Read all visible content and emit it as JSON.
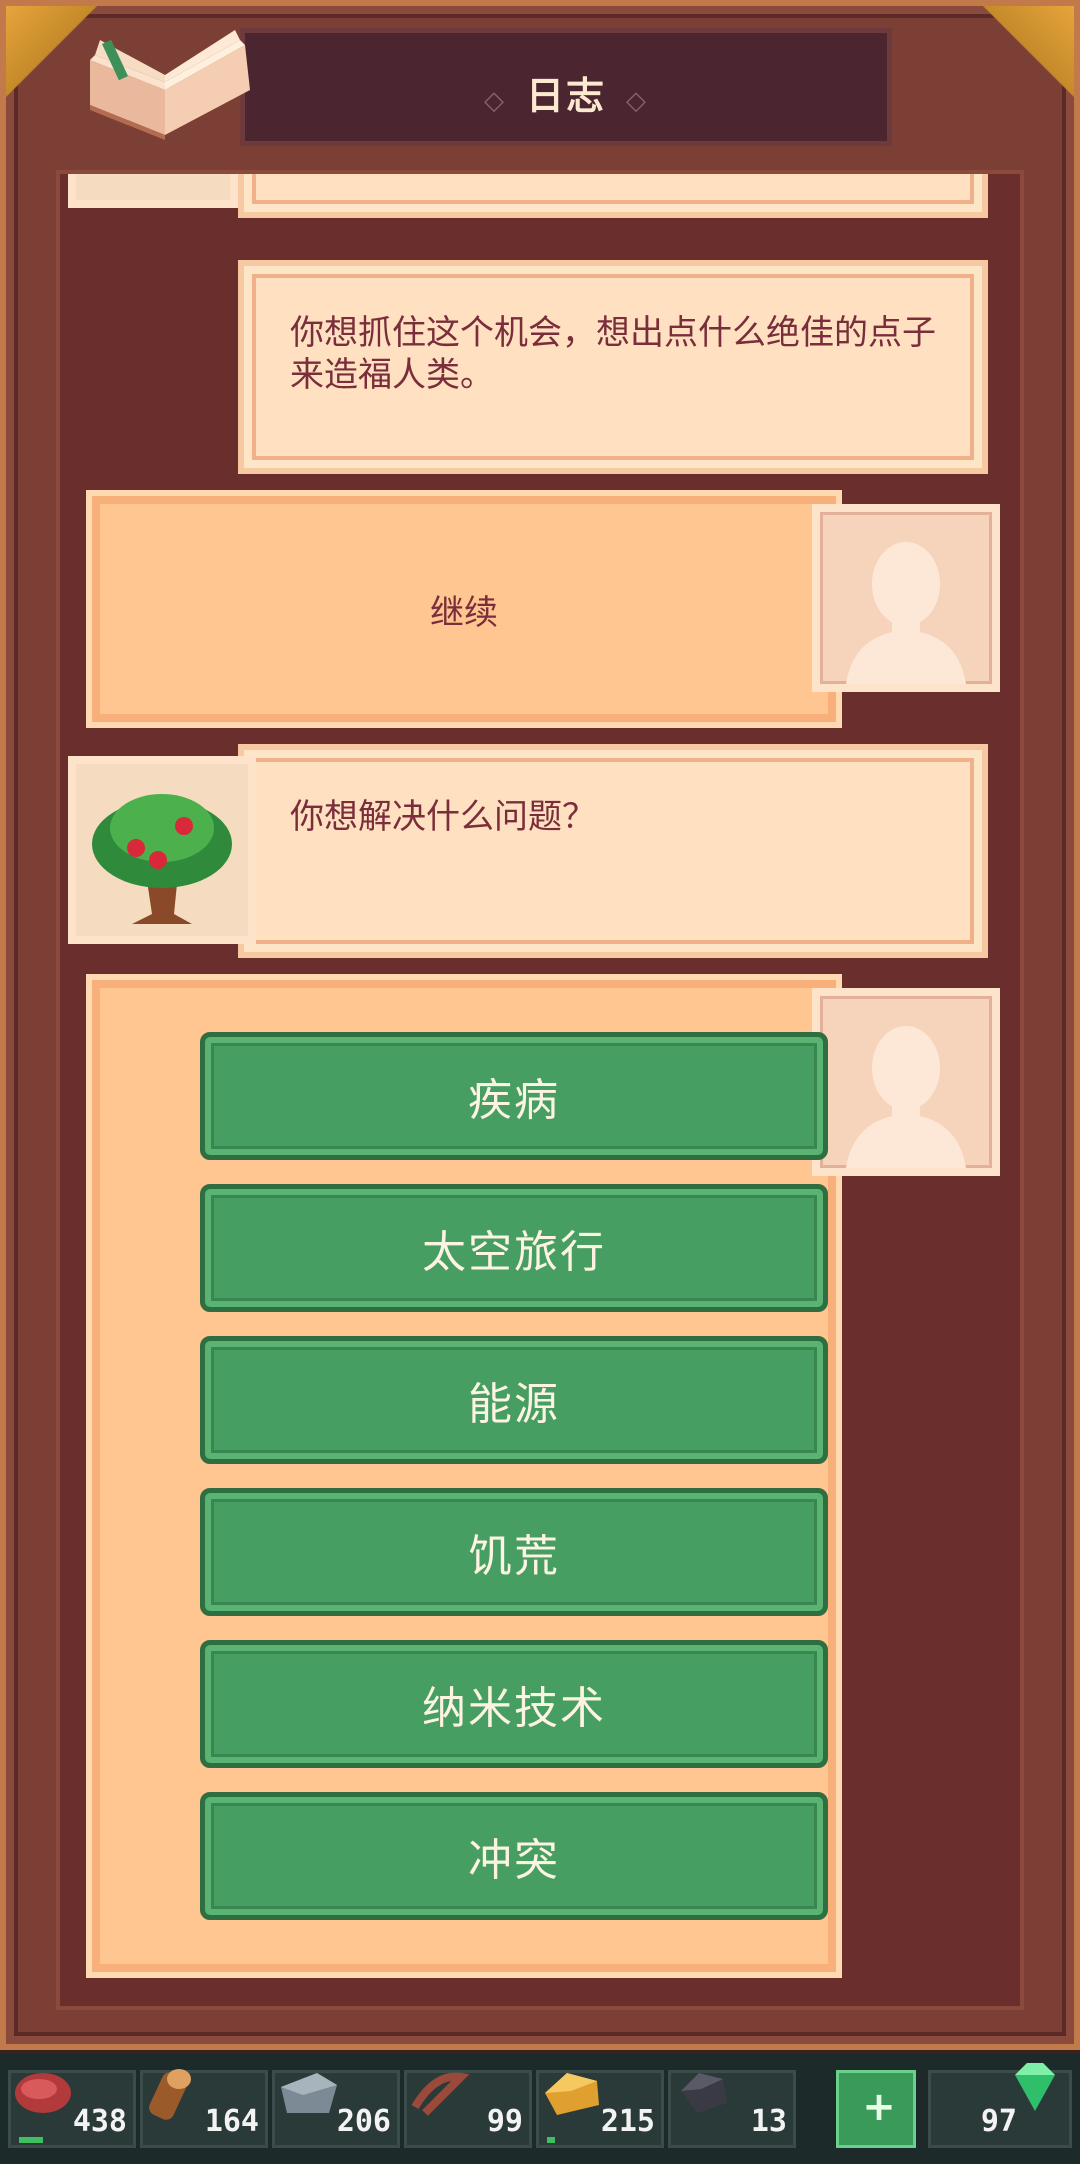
{
  "header": {
    "title": "日志"
  },
  "log": {
    "narration_1": "你想抓住这个机会，想出点什么绝佳的点子来造福人类。",
    "continue_label": "继续",
    "question": "你想解决什么问题？",
    "options": [
      "疾病",
      "太空旅行",
      "能源",
      "饥荒",
      "纳米技术",
      "冲突"
    ]
  },
  "resources": [
    {
      "name": "meat",
      "value": "438"
    },
    {
      "name": "wood",
      "value": "164"
    },
    {
      "name": "stone",
      "value": "206"
    },
    {
      "name": "rope",
      "value": "99"
    },
    {
      "name": "gold",
      "value": "215"
    },
    {
      "name": "coal",
      "value": "13"
    },
    {
      "name": "add-gems",
      "value": ""
    },
    {
      "name": "gems",
      "value": "97"
    }
  ],
  "colors": {
    "accent_green": "#479e62",
    "paper": "#ffe1c1",
    "choice": "#ffc691",
    "text": "#7a2d3a"
  }
}
